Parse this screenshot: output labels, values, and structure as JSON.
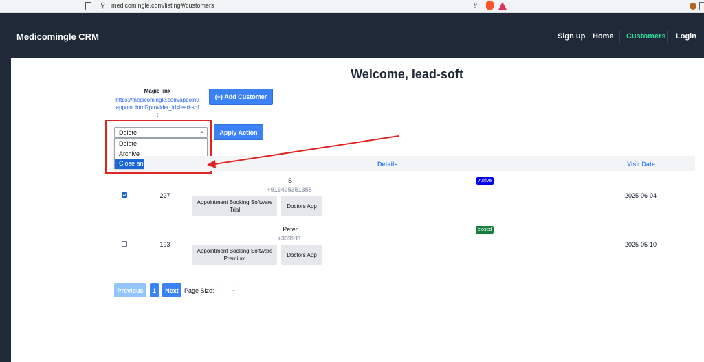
{
  "browser": {
    "url": "medicomingle.com/listing#/customers"
  },
  "navbar": {
    "brand": "Medicomingle CRM",
    "items": [
      "Sign up",
      "Home",
      "Customers",
      "Login"
    ],
    "active": "Customers"
  },
  "page": {
    "welcome": "Welcome, lead-soft",
    "magic_link_title": "Magic link",
    "magic_link_url": "https://medicomingle.com/appoint/appoint.html?provider_id=lead-soft",
    "add_customer_label": "(+) Add Customer",
    "apply_action_label": "Apply Action"
  },
  "bulk_action": {
    "selected": "Delete",
    "options": [
      "Delete",
      "Archive",
      "Close and Take Next Enquiry"
    ],
    "highlighted": "Close and Take Next Enquiry"
  },
  "table": {
    "headers": {
      "details": "Details",
      "visit_date": "Visit Date"
    },
    "rows": [
      {
        "checked": true,
        "id": "227",
        "name": "S",
        "phone": "+919405351358",
        "tags": [
          "Appointment Booking Software Trial",
          "Doctors App"
        ],
        "status": "Active",
        "visit_date": "2025-06-04"
      },
      {
        "checked": false,
        "id": "193",
        "name": "Peter",
        "phone": "+339911",
        "tags": [
          "Appointment Booking Software Premium",
          "Doctors App"
        ],
        "status": "closed",
        "visit_date": "2025-05-10"
      }
    ]
  },
  "pagination": {
    "previous": "Previous",
    "current_page": "1",
    "next": "Next",
    "page_size_label": "Page Size:",
    "page_size_value": ""
  },
  "colors": {
    "navbar_bg": "#1f2937",
    "accent": "#3b82f6",
    "active_nav": "#34d399",
    "annotation": "#e02424"
  },
  "icons": [
    "bookmark-icon",
    "site-settings-icon",
    "share-icon",
    "brave-shield-icon",
    "brave-rewards-icon",
    "extension-icon",
    "sidebar-icon",
    "chevron-down-icon",
    "annotation-arrow-icon"
  ]
}
